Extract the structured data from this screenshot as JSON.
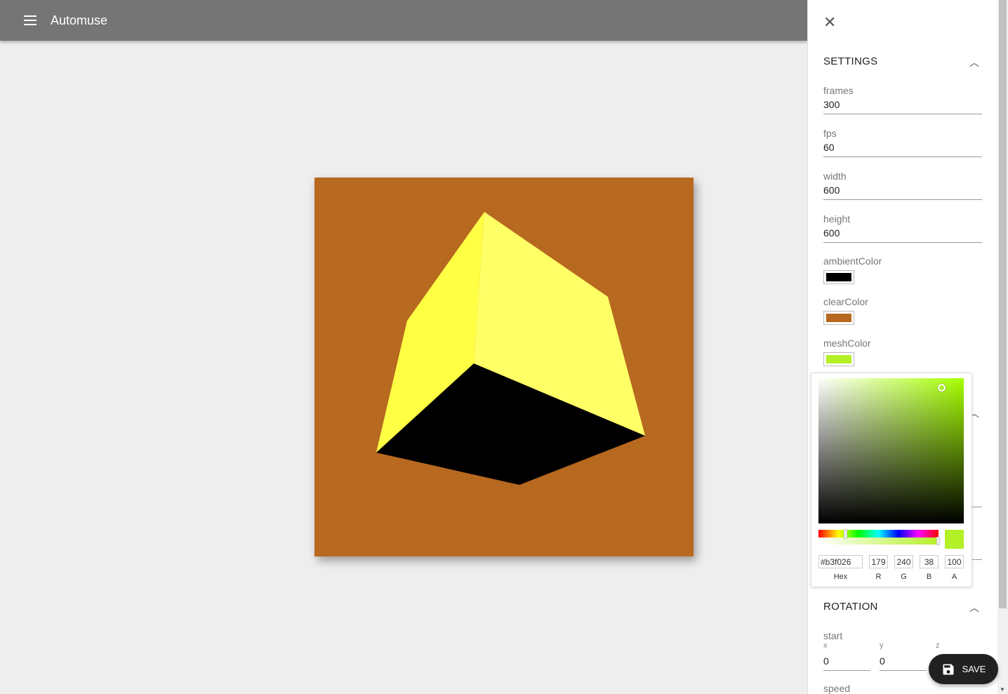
{
  "app": {
    "title": "Automuse",
    "menu_icon": "menu-icon"
  },
  "canvas": {
    "clear_color": "#b86920",
    "face_left": "#ffff44",
    "face_right": "#ffff66",
    "face_bottom": "#000000"
  },
  "drawer": {
    "settings": {
      "title": "SETTINGS",
      "frames": {
        "label": "frames",
        "value": "300"
      },
      "fps": {
        "label": "fps",
        "value": "60"
      },
      "width": {
        "label": "width",
        "value": "600"
      },
      "height": {
        "label": "height",
        "value": "600"
      },
      "ambientColor": {
        "label": "ambientColor",
        "color": "#000000"
      },
      "clearColor": {
        "label": "clearColor",
        "color": "#b86920"
      },
      "meshColor": {
        "label": "meshColor",
        "color": "#b3f026"
      }
    },
    "rotation": {
      "title": "ROTATION",
      "start_label": "start",
      "x_label": "x",
      "y_label": "y",
      "z_label": "z",
      "x": "0",
      "y": "0",
      "speed_label": "speed"
    }
  },
  "picker": {
    "hex": "#b3f026",
    "r": "179",
    "g": "240",
    "b": "38",
    "a": "100",
    "hex_label": "Hex",
    "r_label": "R",
    "g_label": "G",
    "b_label": "B",
    "a_label": "A",
    "hue_fraction": 0.22,
    "alpha_fraction": 1.0
  },
  "save": {
    "label": "SAVE"
  }
}
